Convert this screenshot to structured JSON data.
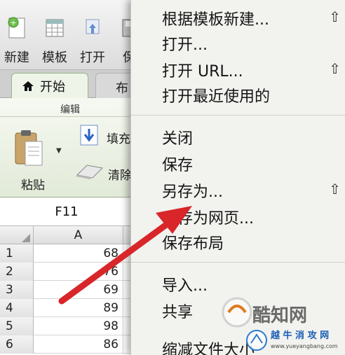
{
  "toolbar": {
    "new_label": "新建",
    "template_label": "模板",
    "open_label": "打开",
    "save_label": "保"
  },
  "tabs": {
    "home": "开始",
    "layout": "布"
  },
  "ribbon": {
    "group_label": "编辑",
    "paste_label": "粘贴",
    "fill_label": "填充",
    "clear_label": "清除"
  },
  "namebox": {
    "value": "F11"
  },
  "sheet": {
    "column_header": "A",
    "rows": [
      {
        "num": "1",
        "value": "68"
      },
      {
        "num": "2",
        "value": "76"
      },
      {
        "num": "3",
        "value": "69"
      },
      {
        "num": "4",
        "value": "89"
      },
      {
        "num": "5",
        "value": "98"
      },
      {
        "num": "6",
        "value": "86"
      }
    ]
  },
  "file_menu": {
    "items": [
      {
        "label": "根据模板新建...",
        "shortcut": "⇧"
      },
      {
        "label": "打开...",
        "shortcut": ""
      },
      {
        "label": "打开 URL...",
        "shortcut": "⇧"
      },
      {
        "label": "打开最近使用的",
        "shortcut": ""
      },
      {
        "label": "关闭",
        "shortcut": ""
      },
      {
        "label": "保存",
        "shortcut": ""
      },
      {
        "label": "另存为...",
        "shortcut": "⇧"
      },
      {
        "label": "另存为网页...",
        "shortcut": ""
      },
      {
        "label": "保存布局",
        "shortcut": ""
      },
      {
        "label": "导入...",
        "shortcut": ""
      },
      {
        "label": "共享",
        "shortcut": ""
      },
      {
        "label": "缩减文件大小",
        "shortcut": ""
      }
    ]
  },
  "watermark": {
    "brand": "酷知网",
    "site": "越 牛 消 攻 网",
    "url": "www.yueyangbang.com"
  },
  "colors": {
    "arrow": "#d8262a",
    "menu_bg": "#f2f2ef",
    "ribbon_bg": "#eaf0e2"
  }
}
